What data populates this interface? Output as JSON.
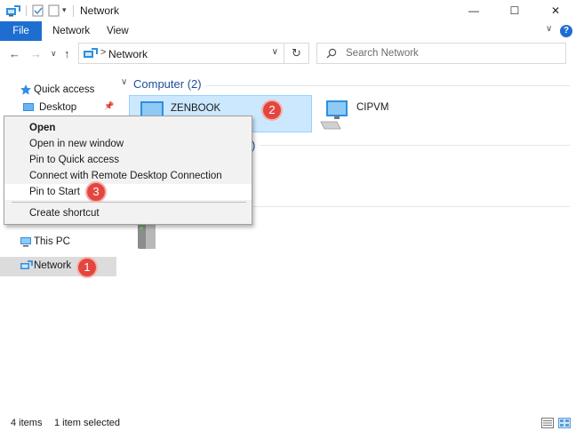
{
  "window": {
    "title": "Network",
    "controls": {
      "minimize": "—",
      "maximize": "☐",
      "close": "✕"
    }
  },
  "ribbon": {
    "tabs": [
      "File",
      "Network",
      "View"
    ],
    "expand_chevron": "∨",
    "help": "?"
  },
  "nav": {
    "back": "←",
    "forward": "→",
    "recent": "∨",
    "up": "↑",
    "address_sep": ">",
    "address": "Network",
    "address_dropdown": "∨",
    "refresh": "↻",
    "search_placeholder": "Search Network"
  },
  "sidebar": {
    "items": [
      {
        "label": "Quick access",
        "icon": "star-icon"
      },
      {
        "label": "Desktop",
        "icon": "desktop-icon",
        "pinned": true
      },
      {
        "label": "This PC",
        "icon": "computer-icon"
      },
      {
        "label": "Network",
        "icon": "network-icon",
        "selected": true
      }
    ]
  },
  "content": {
    "groups": [
      {
        "header": "Computer (2)"
      }
    ],
    "partial_header_fragment": ")",
    "computers": [
      {
        "name": "ZENBOOK",
        "selected": true
      },
      {
        "name": "CIPVM"
      }
    ]
  },
  "context_menu": {
    "items": [
      {
        "label": "Open",
        "bold": true
      },
      {
        "label": "Open in new window"
      },
      {
        "label": "Pin to Quick access"
      },
      {
        "label": "Connect with Remote Desktop Connection"
      },
      {
        "label": "Pin to Start",
        "highlighted": true
      },
      {
        "label": "Create shortcut"
      }
    ]
  },
  "markers": [
    "1",
    "2",
    "3"
  ],
  "status": {
    "item_count": "4 items",
    "selection": "1 item selected"
  },
  "colors": {
    "accent": "#1e6ed1",
    "selection_bg": "#cce8ff",
    "marker": "#e3463f",
    "group_header": "#1f4e9c"
  }
}
